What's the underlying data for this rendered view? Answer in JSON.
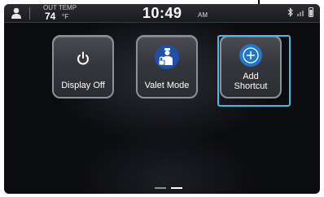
{
  "status_bar": {
    "out_temp_label": "OUT TEMP",
    "out_temp_value": "74",
    "temp_unit": "°F",
    "clock_time": "10:49",
    "clock_ampm": "AM",
    "icons": [
      "profile-icon",
      "bluetooth-icon",
      "signal-icon",
      "phone-battery-icon"
    ]
  },
  "shortcuts": [
    {
      "label": "Display Off",
      "icon": "power-icon"
    },
    {
      "label": "Valet Mode",
      "icon": "valet-mode-icon"
    },
    {
      "label_line1": "Add",
      "label_line2": "Shortcut",
      "icon": "add-icon"
    }
  ],
  "pagination": {
    "pages": 2,
    "current": 1
  },
  "colors": {
    "focus_highlight": "#4fb6e4",
    "valet_badge": "#1f4fa8",
    "add_badge": "#1f78c9",
    "tile_border": "#8e9096"
  }
}
